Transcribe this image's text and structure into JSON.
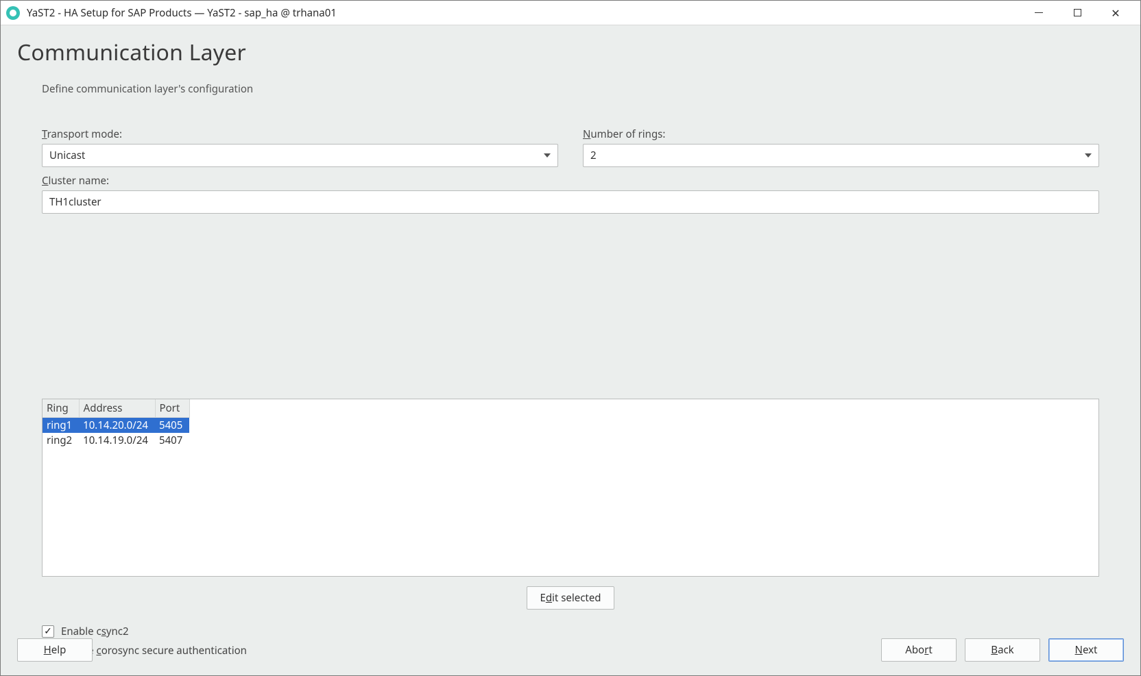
{
  "window": {
    "title": "YaST2 - HA Setup for SAP Products — YaST2 - sap_ha @ trhana01"
  },
  "page": {
    "title": "Communication Layer",
    "subtitle": "Define communication layer's configuration"
  },
  "fields": {
    "transport_mode": {
      "label_pre": "T",
      "label_rest": "ransport mode:",
      "value": "Unicast"
    },
    "num_rings": {
      "label_pre": "N",
      "label_rest": "umber of rings:",
      "value": "2"
    },
    "cluster_name": {
      "label_pre": "C",
      "label_rest": "luster name:",
      "value": "TH1cluster"
    }
  },
  "table": {
    "headers": {
      "ring": "Ring",
      "address": "Address",
      "port": "Port"
    },
    "rows": [
      {
        "ring": "ring1",
        "address": "10.14.20.0/24",
        "port": "5405",
        "selected": true
      },
      {
        "ring": "ring2",
        "address": "10.14.19.0/24",
        "port": "5407",
        "selected": false
      }
    ]
  },
  "buttons": {
    "edit_pre": "E",
    "edit_mid": "d",
    "edit_rest": "it selected",
    "help_pre": "H",
    "help_rest": "elp",
    "abort_pre": "Abo",
    "abort_mid": "r",
    "abort_rest": "t",
    "back_pre": "B",
    "back_rest": "ack",
    "next_pre": "N",
    "next_rest": "ext"
  },
  "checks": {
    "csync2": {
      "checked": true,
      "label_pre": "Enable c",
      "label_mid": "s",
      "label_rest": "ync2"
    },
    "corosync": {
      "checked": false,
      "label_pre": "Enable ",
      "label_mid": "c",
      "label_rest": "orosync secure authentication"
    }
  }
}
